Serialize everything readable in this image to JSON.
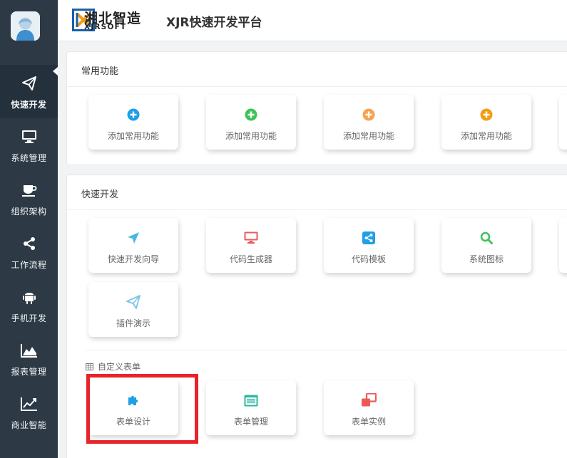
{
  "app": {
    "logo_cn": "湘北智造",
    "logo_en": "XJRSOFT",
    "title": "XJR快速开发平台"
  },
  "sidebar": {
    "items": [
      {
        "label": "快速开发",
        "icon": "paper-plane-icon",
        "active": true
      },
      {
        "label": "系统管理",
        "icon": "monitor-icon"
      },
      {
        "label": "组织架构",
        "icon": "coffee-cup-icon"
      },
      {
        "label": "工作流程",
        "icon": "share-icon"
      },
      {
        "label": "手机开发",
        "icon": "android-icon"
      },
      {
        "label": "报表管理",
        "icon": "area-chart-icon"
      },
      {
        "label": "商业智能",
        "icon": "line-chart-icon"
      }
    ]
  },
  "common": {
    "title": "常用功能",
    "cards": [
      {
        "label": "添加常用功能",
        "icon": "plus-circle-icon",
        "color": "#1e9fe6"
      },
      {
        "label": "添加常用功能",
        "icon": "plus-circle-icon",
        "color": "#3fc35a"
      },
      {
        "label": "添加常用功能",
        "icon": "plus-circle-icon",
        "color": "#f6a352"
      },
      {
        "label": "添加常用功能",
        "icon": "plus-circle-icon",
        "color": "#f39c12"
      }
    ]
  },
  "quick": {
    "title": "快速开发",
    "cards": [
      {
        "label": "快速开发向导",
        "icon": "location-arrow-icon",
        "color": "#47b8e0"
      },
      {
        "label": "代码生成器",
        "icon": "desktop-icon",
        "color": "#ec5a5a"
      },
      {
        "label": "代码模板",
        "icon": "share-square-icon",
        "color": "#1e9fe6"
      },
      {
        "label": "系统图标",
        "icon": "search-icon",
        "color": "#3fc35a"
      },
      {
        "label": "插件演示",
        "icon": "paper-plane-icon",
        "color": "#7ec3e8"
      }
    ],
    "custom_form": {
      "label": "自定义表单",
      "cards": [
        {
          "label": "表单设计",
          "icon": "puzzle-icon",
          "color": "#1e9fe6"
        },
        {
          "label": "表单管理",
          "icon": "list-window-icon",
          "color": "#2ab7a0"
        },
        {
          "label": "表单实例",
          "icon": "clone-icon",
          "color": "#ec5a5a"
        }
      ]
    }
  },
  "colors": {
    "sidebar_bg": "#2d3a46",
    "highlight": "#e8232a"
  }
}
